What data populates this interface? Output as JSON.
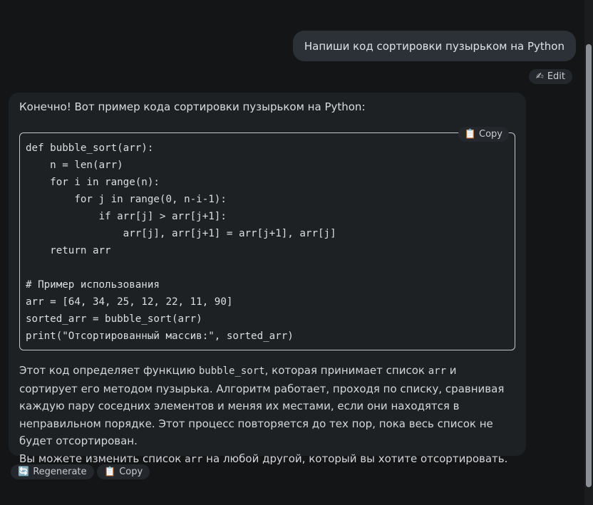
{
  "user_message": "Напиши код сортировки пузырьком на Python",
  "user_actions": {
    "edit_icon": "✍",
    "edit_label": "Edit"
  },
  "assistant": {
    "intro": "Конечно! Вот пример кода сортировки пузырьком на Python:",
    "code_copy_icon": "📋",
    "code_copy_label": "Copy",
    "code": "def bubble_sort(arr):\n    n = len(arr)\n    for i in range(n):\n        for j in range(0, n-i-1):\n            if arr[j] > arr[j+1]:\n                arr[j], arr[j+1] = arr[j+1], arr[j]\n    return arr\n\n# Пример использования\narr = [64, 34, 25, 12, 22, 11, 90]\nsorted_arr = bubble_sort(arr)\nprint(\"Отсортированный массив:\", sorted_arr)",
    "explain_p1_before": "Этот код определяет функцию ",
    "explain_p1_code1": "bubble_sort",
    "explain_p1_mid": ", которая принимает список ",
    "explain_p1_code2": "arr",
    "explain_p1_after": " и сортирует его методом пузырька. Алгоритм работает, проходя по списку, сравнивая каждую пару соседних элементов и меняя их местами, если они находятся в неправильном порядке. Этот процесс повторяется до тех пор, пока весь список не будет отсортирован.",
    "explain_p2_before": "Вы можете изменить список ",
    "explain_p2_code": "arr",
    "explain_p2_after": " на любой другой, который вы хотите отсортировать."
  },
  "assistant_actions": {
    "regenerate_icon": "🔄",
    "regenerate_label": "Regenerate",
    "copy_icon": "📋",
    "copy_label": "Copy"
  },
  "colors": {
    "background": "#141517",
    "user_bubble": "#2b3137",
    "assistant_bubble": "#1e2124",
    "pill": "#24282c"
  }
}
